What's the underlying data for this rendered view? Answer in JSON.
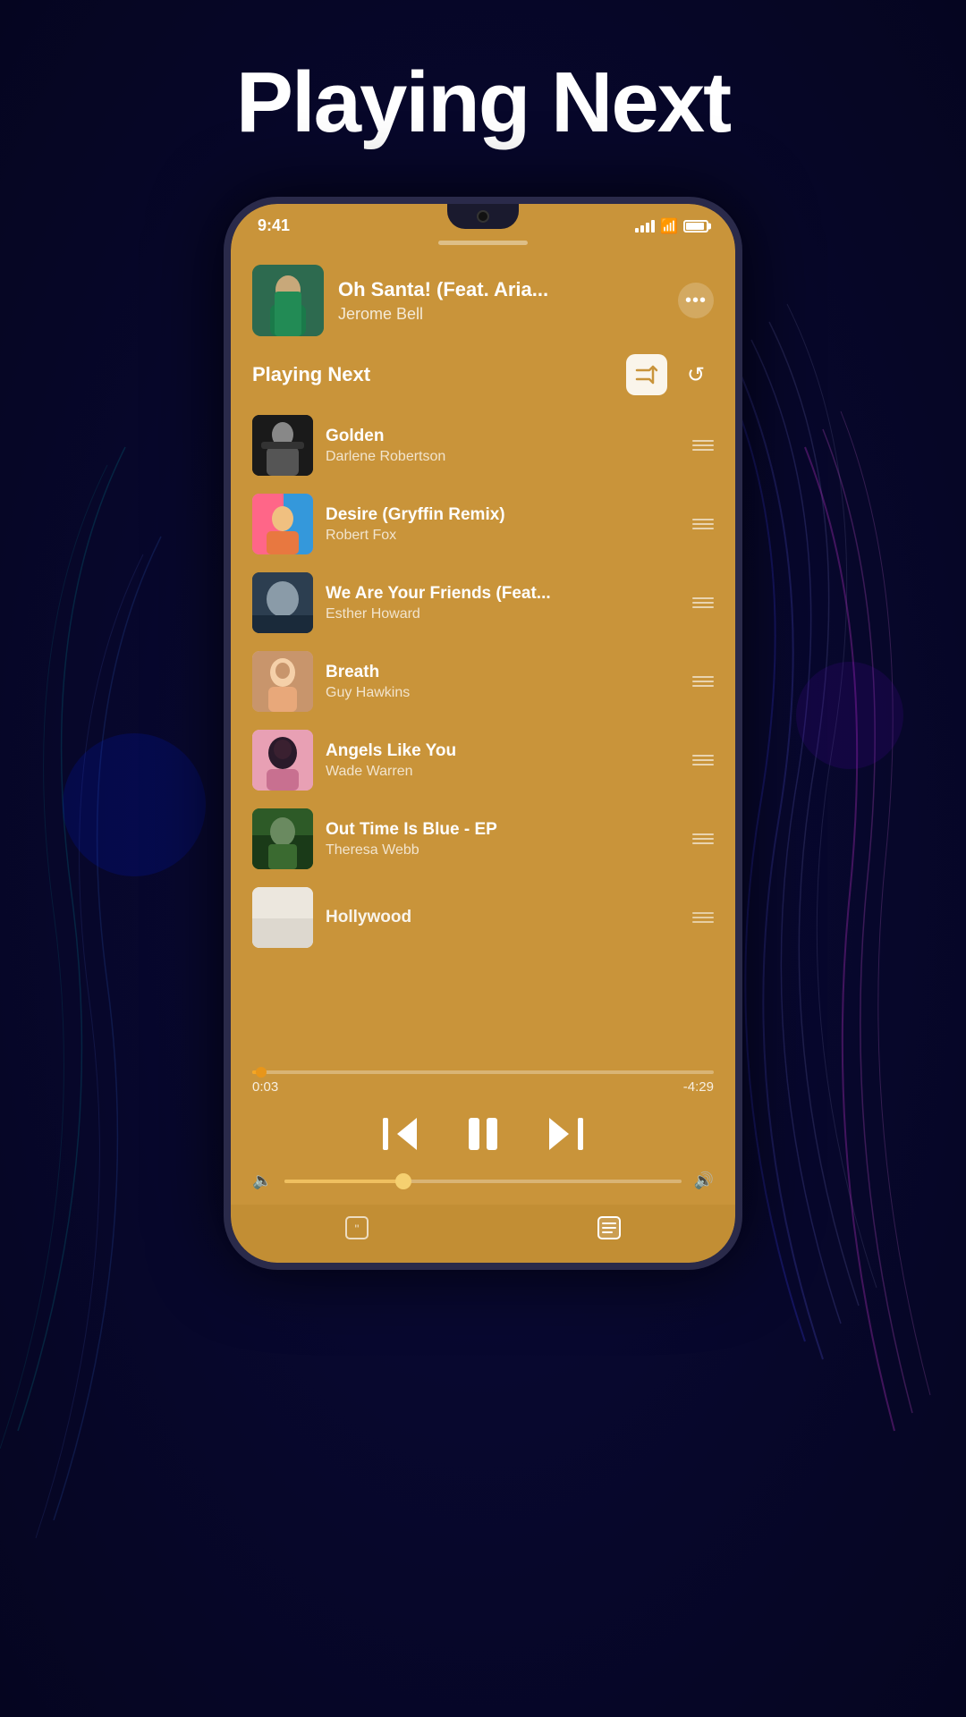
{
  "page": {
    "title": "Playing Next",
    "background_color": "#050520"
  },
  "status_bar": {
    "time": "9:41",
    "signal_level": 4,
    "wifi": true,
    "battery_percent": 85
  },
  "now_playing": {
    "title": "Oh Santa! (Feat. Aria...",
    "artist": "Jerome Bell",
    "more_label": "⋯"
  },
  "playing_next": {
    "label": "Playing Next",
    "shuffle_icon": "⇄",
    "repeat_icon": "↺"
  },
  "tracks": [
    {
      "id": 1,
      "title": "Golden",
      "artist": "Darlene Robertson",
      "art_class": "track-art-1"
    },
    {
      "id": 2,
      "title": "Desire (Gryffin Remix)",
      "artist": "Robert Fox",
      "art_class": "track-art-2"
    },
    {
      "id": 3,
      "title": "We Are Your Friends (Feat...",
      "artist": "Esther Howard",
      "art_class": "track-art-3"
    },
    {
      "id": 4,
      "title": "Breath",
      "artist": "Guy Hawkins",
      "art_class": "track-art-4"
    },
    {
      "id": 5,
      "title": "Angels Like You",
      "artist": "Wade Warren",
      "art_class": "track-art-5"
    },
    {
      "id": 6,
      "title": "Out Time Is Blue - EP",
      "artist": "Theresa Webb",
      "art_class": "track-art-6"
    },
    {
      "id": 7,
      "title": "Hollywood",
      "artist": "",
      "art_class": "track-art-7"
    }
  ],
  "progress": {
    "current": "0:03",
    "remaining": "-4:29",
    "percent": 2
  },
  "controls": {
    "prev_icon": "⏮",
    "pause_icon": "⏸",
    "next_icon": "⏭",
    "vol_low_icon": "🔈",
    "vol_high_icon": "🔊"
  },
  "bottom_tabs": [
    {
      "icon": "💬",
      "label": "lyrics",
      "active": false
    },
    {
      "icon": "📋",
      "label": "queue",
      "active": true
    }
  ]
}
